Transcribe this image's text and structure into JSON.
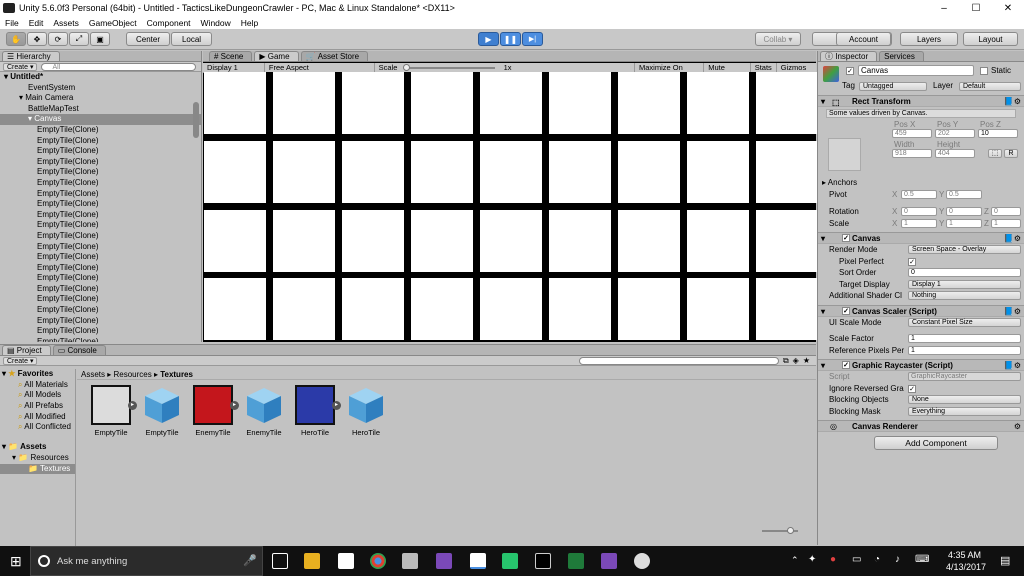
{
  "window": {
    "title": "Unity 5.6.0f3 Personal (64bit) - Untitled - TacticsLikeDungeonCrawler - PC, Mac & Linux Standalone* <DX11>",
    "min": "–",
    "max": "☐",
    "close": "✕"
  },
  "menu": [
    "File",
    "Edit",
    "Assets",
    "GameObject",
    "Component",
    "Window",
    "Help"
  ],
  "toolbar": {
    "center": "Center",
    "local": "Local",
    "collab": "Collab ▾",
    "account": "Account",
    "layers": "Layers",
    "layout": "Layout",
    "play": "▶",
    "pause": "❚❚",
    "step": "▶|"
  },
  "hierarchy": {
    "tab": "Hierarchy",
    "create": "Create ▾",
    "search": "All",
    "scene": "Untitled*",
    "items": [
      {
        "label": "EventSystem",
        "indent": 2
      },
      {
        "label": "Main Camera",
        "indent": 1
      },
      {
        "label": "BattleMapTest",
        "indent": 2
      },
      {
        "label": "Canvas",
        "indent": 2,
        "selected": true
      },
      {
        "label": "EmptyTile(Clone)",
        "indent": 3
      },
      {
        "label": "EmptyTile(Clone)",
        "indent": 3
      },
      {
        "label": "EmptyTile(Clone)",
        "indent": 3
      },
      {
        "label": "EmptyTile(Clone)",
        "indent": 3
      },
      {
        "label": "EmptyTile(Clone)",
        "indent": 3
      },
      {
        "label": "EmptyTile(Clone)",
        "indent": 3
      },
      {
        "label": "EmptyTile(Clone)",
        "indent": 3
      },
      {
        "label": "EmptyTile(Clone)",
        "indent": 3
      },
      {
        "label": "EmptyTile(Clone)",
        "indent": 3
      },
      {
        "label": "EmptyTile(Clone)",
        "indent": 3
      },
      {
        "label": "EmptyTile(Clone)",
        "indent": 3
      },
      {
        "label": "EmptyTile(Clone)",
        "indent": 3
      },
      {
        "label": "EmptyTile(Clone)",
        "indent": 3
      },
      {
        "label": "EmptyTile(Clone)",
        "indent": 3
      },
      {
        "label": "EmptyTile(Clone)",
        "indent": 3
      },
      {
        "label": "EmptyTile(Clone)",
        "indent": 3
      },
      {
        "label": "EmptyTile(Clone)",
        "indent": 3
      },
      {
        "label": "EmptyTile(Clone)",
        "indent": 3
      },
      {
        "label": "EmptyTile(Clone)",
        "indent": 3
      },
      {
        "label": "EmptyTile(Clone)",
        "indent": 3
      },
      {
        "label": "EmptyTile(Clone)",
        "indent": 3
      },
      {
        "label": "EmptyTile(Clone)",
        "indent": 3
      },
      {
        "label": "EmptyTile(Clone)",
        "indent": 3
      },
      {
        "label": "EmptyTile(Clone)",
        "indent": 3
      },
      {
        "label": "EmptyTile(Clone)",
        "indent": 3
      }
    ]
  },
  "tabs": {
    "scene": "Scene",
    "game": "Game",
    "asset_store": "Asset Store"
  },
  "game": {
    "display": "Display 1",
    "aspect": "Free Aspect",
    "scale_label": "Scale",
    "scale_value": "1x",
    "maximize": "Maximize On Play",
    "mute": "Mute Audio",
    "stats": "Stats",
    "gizmos": "Gizmos ▾",
    "grid_rows": 4,
    "grid_cols": 9
  },
  "project": {
    "tab_project": "Project",
    "tab_console": "Console",
    "create": "Create ▾",
    "favorites_label": "Favorites",
    "favorites": [
      "All Materials",
      "All Models",
      "All Prefabs",
      "All Modified",
      "All Conflicted"
    ],
    "assets_label": "Assets",
    "resources": "Resources",
    "textures": "Textures",
    "breadcrumb": [
      "Assets",
      "Resources",
      "Textures"
    ],
    "assets": [
      {
        "name": "EmptyTile",
        "type": "texture",
        "color": "#dcdcdc"
      },
      {
        "name": "EmptyTile",
        "type": "prefab"
      },
      {
        "name": "EnemyTile",
        "type": "texture",
        "color": "#c4161c"
      },
      {
        "name": "EnemyTile",
        "type": "prefab"
      },
      {
        "name": "HeroTile",
        "type": "texture",
        "color": "#2b3aa8"
      },
      {
        "name": "HeroTile",
        "type": "prefab"
      }
    ]
  },
  "inspector": {
    "tab": "Inspector",
    "services": "Services",
    "object_name": "Canvas",
    "static": "Static",
    "tag_label": "Tag",
    "tag": "Untagged",
    "layer_label": "Layer",
    "layer": "Default",
    "rect_transform": "Rect Transform",
    "driven_note": "Some values driven by Canvas.",
    "pos_x_label": "Pos X",
    "pos_y_label": "Pos Y",
    "pos_z_label": "Pos Z",
    "pos_x": "459",
    "pos_y": "202",
    "pos_z": "10",
    "width_label": "Width",
    "height_label": "Height",
    "width": "918",
    "height": "404",
    "anchors": "Anchors",
    "pivot": "Pivot",
    "pivot_x": "0.5",
    "pivot_y": "0.5",
    "rotation": "Rotation",
    "rot_x": "0",
    "rot_y": "0",
    "rot_z": "0",
    "scale": "Scale",
    "scale_x": "1",
    "scale_y": "1",
    "scale_z": "1",
    "canvas": "Canvas",
    "render_mode_label": "Render Mode",
    "render_mode": "Screen Space - Overlay",
    "pixel_perfect": "Pixel Perfect",
    "sort_order_label": "Sort Order",
    "sort_order": "0",
    "target_display_label": "Target Display",
    "target_display": "Display 1",
    "add_shader_label": "Additional Shader Cl",
    "add_shader": "Nothing",
    "canvas_scaler": "Canvas Scaler (Script)",
    "ui_scale_label": "UI Scale Mode",
    "ui_scale": "Constant Pixel Size",
    "scale_factor_label": "Scale Factor",
    "scale_factor": "1",
    "ref_pixels_label": "Reference Pixels Per",
    "ref_pixels": "1",
    "graphic_raycaster": "Graphic Raycaster (Script)",
    "script_label": "Script",
    "script": "GraphicRaycaster",
    "ignore_label": "Ignore Reversed Gra",
    "blocking_obj_label": "Blocking Objects",
    "blocking_obj": "None",
    "blocking_mask_label": "Blocking Mask",
    "blocking_mask": "Everything",
    "canvas_renderer": "Canvas Renderer",
    "add_component": "Add Component",
    "r_btn": "R"
  },
  "taskbar": {
    "search": "Ask me anything",
    "time": "4:35 AM",
    "date": "4/13/2017"
  }
}
